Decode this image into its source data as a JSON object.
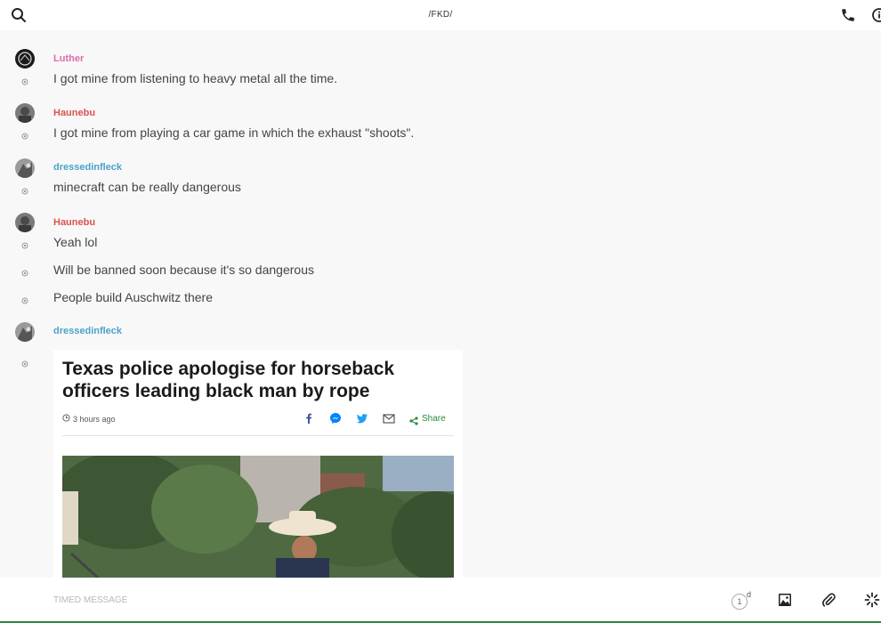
{
  "header": {
    "title": "/FKD/"
  },
  "messages": [
    {
      "author": "Luther",
      "author_color": "#e06aa7",
      "lines": [
        "I got mine from listening to heavy metal all the time."
      ]
    },
    {
      "author": "Haunebu",
      "author_color": "#d9534f",
      "lines": [
        "I got mine from playing a car game in which the exhaust \"shoots\"."
      ]
    },
    {
      "author": "dressedinfleck",
      "author_color": "#4aa3c8",
      "lines": [
        "minecraft can be really dangerous"
      ]
    },
    {
      "author": "Haunebu",
      "author_color": "#d9534f",
      "lines": [
        "Yeah lol",
        "Will be banned soon because it's so dangerous",
        "People build Auschwitz there"
      ]
    },
    {
      "author": "dressedinfleck",
      "author_color": "#4aa3c8"
    }
  ],
  "article": {
    "headline": "Texas police apologise for horseback officers leading black man by rope",
    "time_ago": "3 hours ago",
    "share_label": "Share"
  },
  "composer": {
    "placeholder": "TIMED MESSAGE",
    "timer_value": "1",
    "timer_unit": "d"
  },
  "icons": {
    "search": "search-icon",
    "phone": "phone-icon",
    "info": "info-icon",
    "image": "image-icon",
    "attach": "paperclip-icon",
    "loading": "spinner-icon"
  },
  "colors": {
    "accent": "#2a8a3a",
    "facebook": "#3b5998",
    "messenger": "#0084ff",
    "twitter": "#1da1f2"
  }
}
